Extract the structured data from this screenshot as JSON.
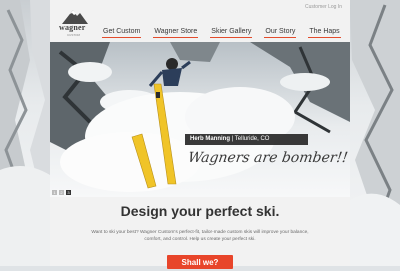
{
  "header": {
    "logo_text": "wagner",
    "logo_sub": "CUSTOM",
    "login_label": "Customer Log In"
  },
  "nav": [
    {
      "label": "Get Custom"
    },
    {
      "label": "Wagner Store"
    },
    {
      "label": "Skier Gallery"
    },
    {
      "label": "Our Story"
    },
    {
      "label": "The Haps"
    }
  ],
  "hero": {
    "caption_name": "Herb Manning",
    "caption_place": " | Telluride, CO",
    "tagline": "Wagners are bomber!!",
    "pager": [
      "1",
      "2",
      "3"
    ],
    "pager_active_index": 2
  },
  "main": {
    "headline": "Design your perfect ski.",
    "body": "Want to ski your best? Wagner Custom's perfect-fit, tailor-made custom skis will improve your balance, comfort, and control. Help us create your perfect ski.",
    "cta_label": "Shall we?"
  },
  "colors": {
    "accent": "#e8452a",
    "nav_underline": "#e34c2c",
    "caption_bg": "#282828"
  }
}
